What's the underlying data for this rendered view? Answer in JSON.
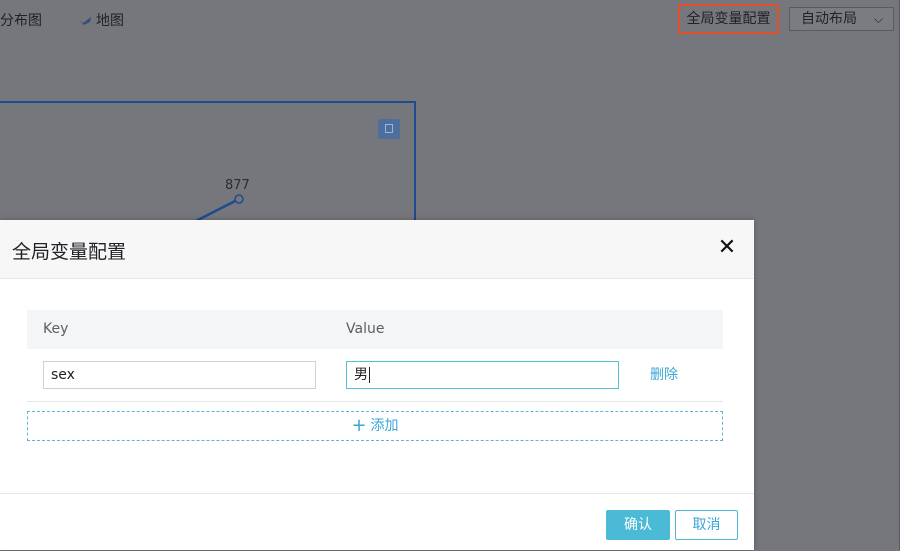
{
  "toolbar": {
    "distribution_tab": "分布图",
    "map_tab": "地图",
    "global_config_button": "全局变量配置",
    "layout_select": "自动布局"
  },
  "canvas": {
    "node_value": "877"
  },
  "modal": {
    "title": "全局变量配置",
    "columns": {
      "key": "Key",
      "value": "Value"
    },
    "rows": [
      {
        "key": "sex",
        "value": "男",
        "delete_label": "删除"
      }
    ],
    "add_label": "添加",
    "confirm_label": "确认",
    "cancel_label": "取消"
  },
  "colors": {
    "accent": "#4bbad6",
    "highlight_border": "#e0502a",
    "canvas_frame": "#1e4b8f"
  }
}
